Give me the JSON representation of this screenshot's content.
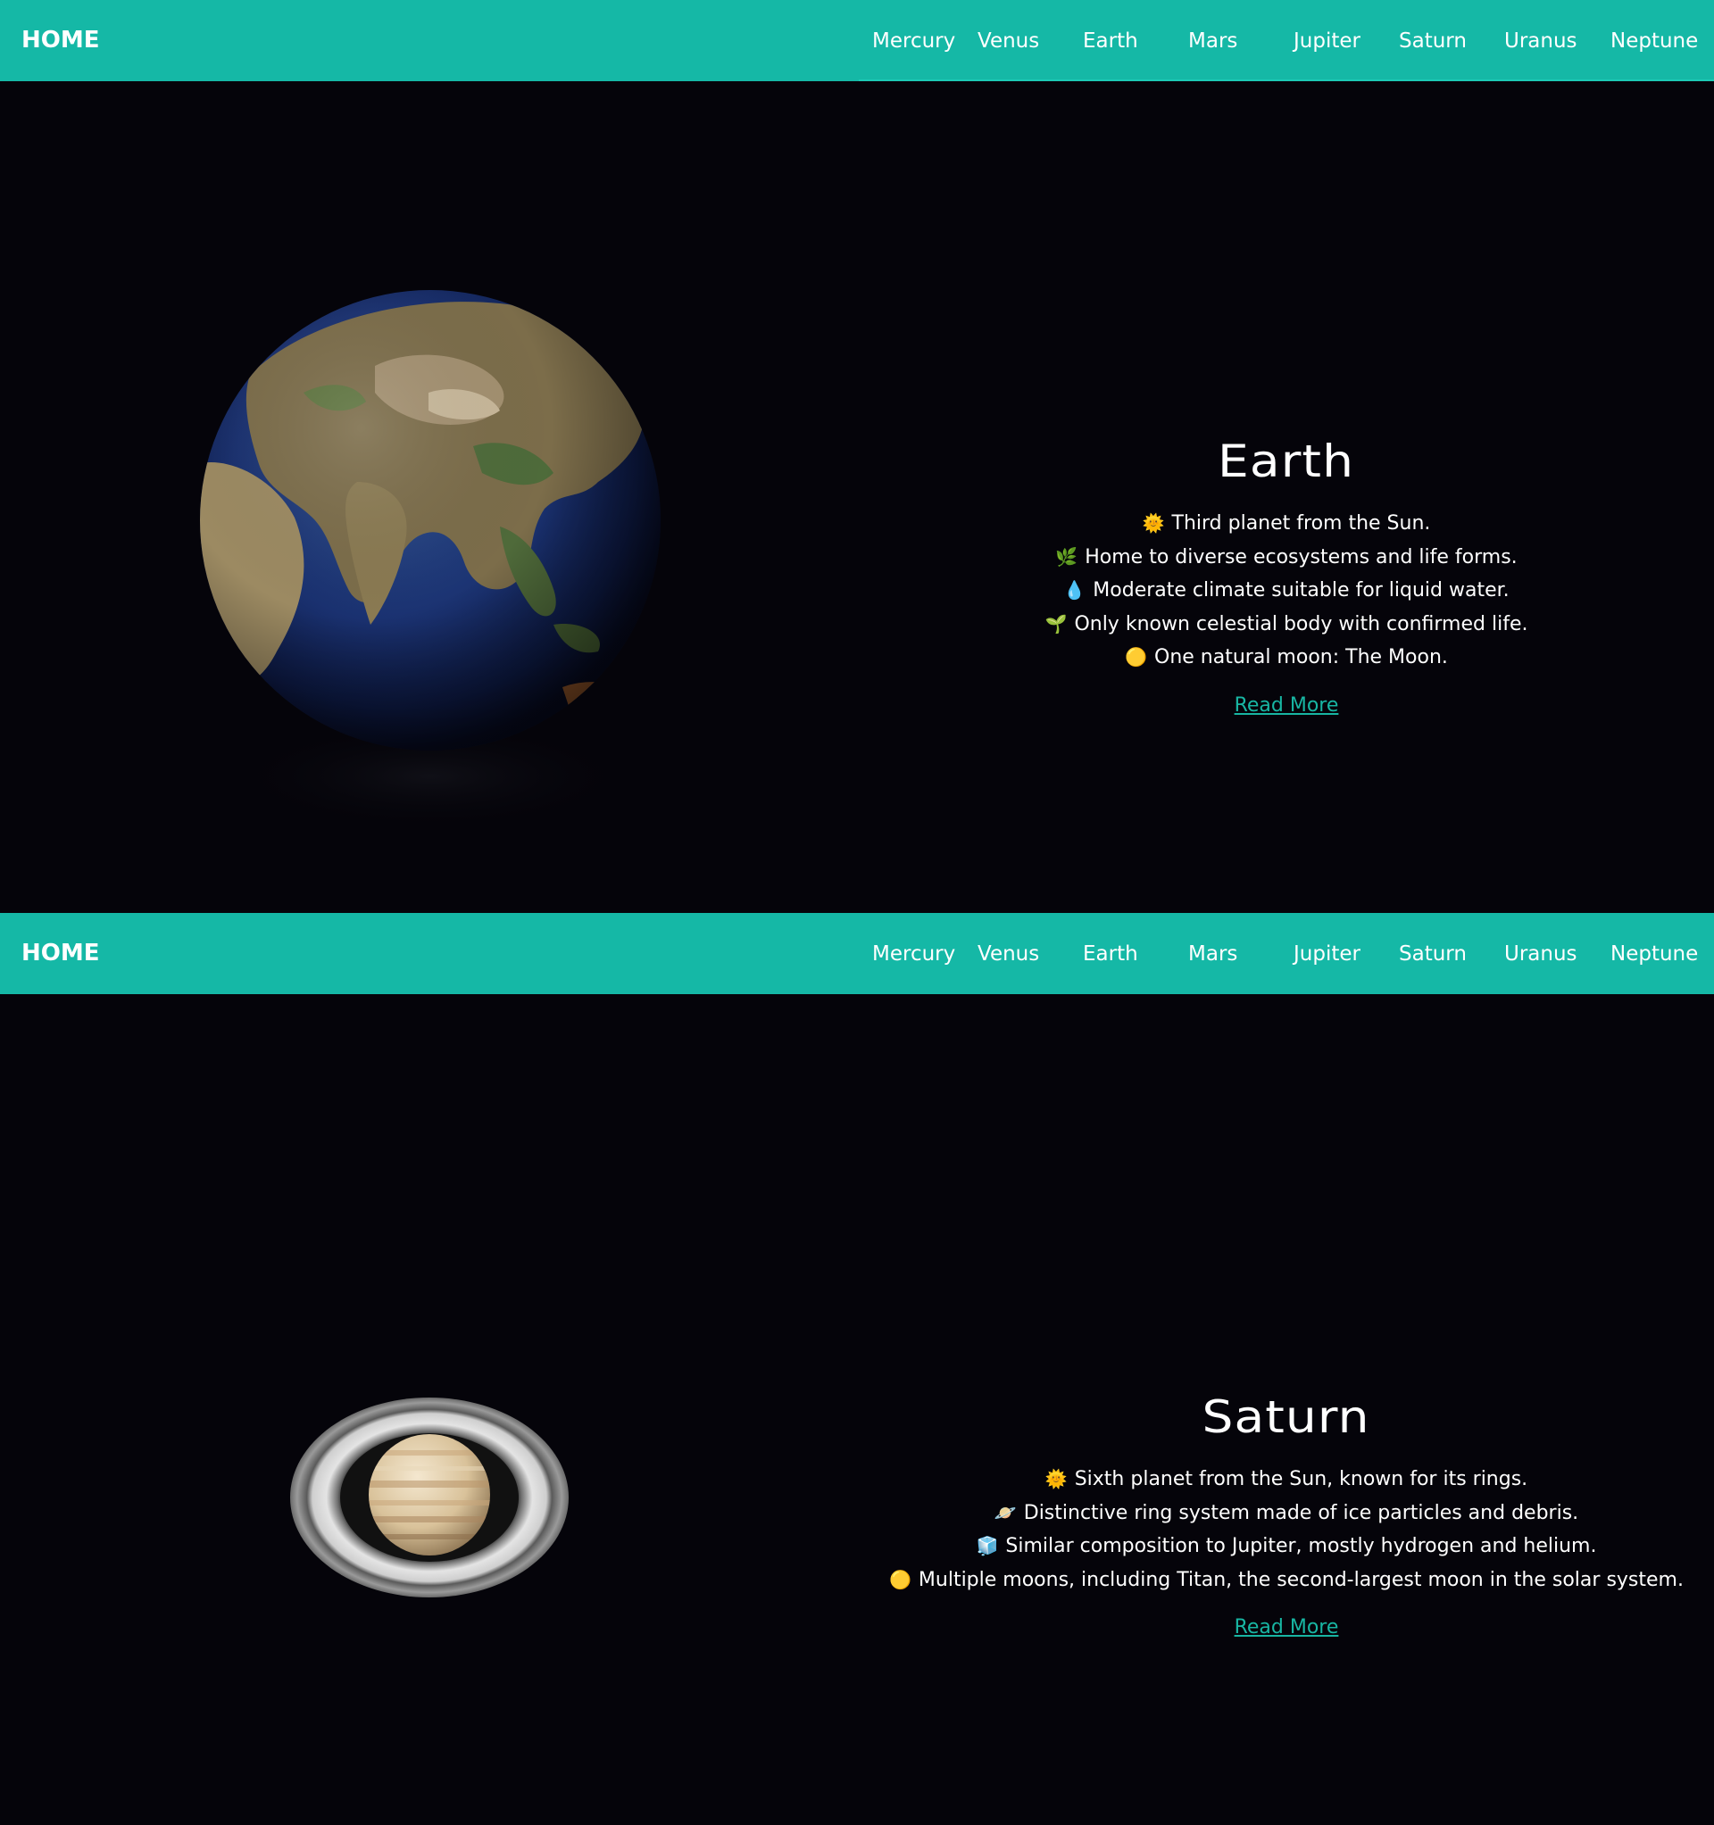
{
  "nav": {
    "home": "HOME",
    "links": [
      "Mercury",
      "Venus",
      "Earth",
      "Mars",
      "Jupiter",
      "Saturn",
      "Uranus",
      "Neptune"
    ]
  },
  "colors": {
    "nav_bg": "#15b8a6",
    "page_bg": "#05040a",
    "link": "#18b6a3"
  },
  "sections": [
    {
      "title": "Earth",
      "facts": [
        {
          "icon": "sun-icon",
          "glyph": "🌞",
          "text": "Third planet from the Sun."
        },
        {
          "icon": "herb-icon",
          "glyph": "🌿",
          "text": "Home to diverse ecosystems and life forms."
        },
        {
          "icon": "droplet-icon",
          "glyph": "💧",
          "text": "Moderate climate suitable for liquid water."
        },
        {
          "icon": "seedling-icon",
          "glyph": "🌱",
          "text": "Only known celestial body with confirmed life."
        },
        {
          "icon": "moon-dot-icon",
          "glyph": "🟡",
          "text": "One natural moon: The Moon."
        }
      ],
      "read_more": "Read More"
    },
    {
      "title": "Saturn",
      "facts": [
        {
          "icon": "sun-icon",
          "glyph": "🌞",
          "text": "Sixth planet from the Sun, known for its rings."
        },
        {
          "icon": "ringed-planet-icon",
          "glyph": "🪐",
          "text": "Distinctive ring system made of ice particles and debris."
        },
        {
          "icon": "cube-icon",
          "glyph": "🧊",
          "text": "Similar composition to Jupiter, mostly hydrogen and helium."
        },
        {
          "icon": "moon-dot-icon",
          "glyph": "🟡",
          "text": "Multiple moons, including Titan, the second-largest moon in the solar system."
        }
      ],
      "read_more": "Read More"
    }
  ]
}
